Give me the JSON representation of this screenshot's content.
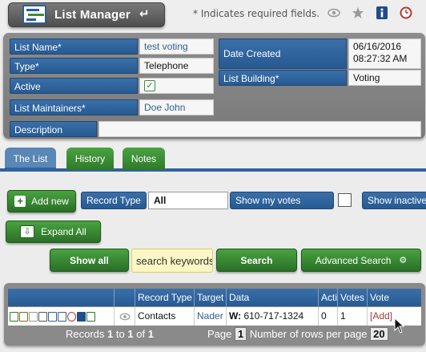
{
  "header": {
    "title": "List Manager",
    "back_glyph": "↵",
    "required_note": "* Indicates required fields.",
    "icons": [
      "eye-icon",
      "star-icon",
      "info-icon",
      "clock-icon"
    ]
  },
  "form": {
    "list_name": {
      "label": "List Name*",
      "value": "test voting"
    },
    "type": {
      "label": "Type*",
      "value": "Telephone"
    },
    "active": {
      "label": "Active",
      "checked": true
    },
    "list_maintainers": {
      "label": "List Maintainers*",
      "value": "Doe John"
    },
    "description": {
      "label": "Description",
      "value": ""
    },
    "date_created": {
      "label": "Date Created",
      "date": "06/16/2016",
      "time": "08:27:32 AM"
    },
    "list_building": {
      "label": "List Building*",
      "value": "Voting"
    }
  },
  "tabs": [
    {
      "label": "The List",
      "active": true
    },
    {
      "label": "History",
      "active": false
    },
    {
      "label": "Notes",
      "active": false
    }
  ],
  "toolbar": {
    "add_new": "Add new",
    "record_type_label": "Record Type",
    "record_type_value": "All",
    "show_my_votes": "Show my votes",
    "show_inactive": "Show inactive",
    "expand_all": "Expand All",
    "show_all": "Show all",
    "search_placeholder": "search keywords",
    "search": "Search",
    "advanced_search": "Advanced Search"
  },
  "grid": {
    "columns": [
      "Record Type",
      "Target",
      "Data",
      "Active",
      "Votes",
      "Vote"
    ],
    "rows": [
      {
        "record_type": "Contacts",
        "target": "Nader",
        "data_prefix": "W:",
        "data_value": "610-717-1324",
        "active": "0",
        "votes": "1",
        "vote": "[Add]"
      }
    ],
    "footer": {
      "records_text_1": "Records",
      "records_from": "1",
      "records_to_word": "to",
      "records_to": "1",
      "records_of_word": "of",
      "records_total": "1",
      "page_label": "Page",
      "page_value": "1",
      "rows_label": "Number of rows per page",
      "rows_value": "20"
    }
  },
  "colors": {
    "label_blue": "#2f64a0",
    "button_green": "#3a8a34",
    "panel_gray": "#828282",
    "vote_link": "#a33a3a"
  }
}
